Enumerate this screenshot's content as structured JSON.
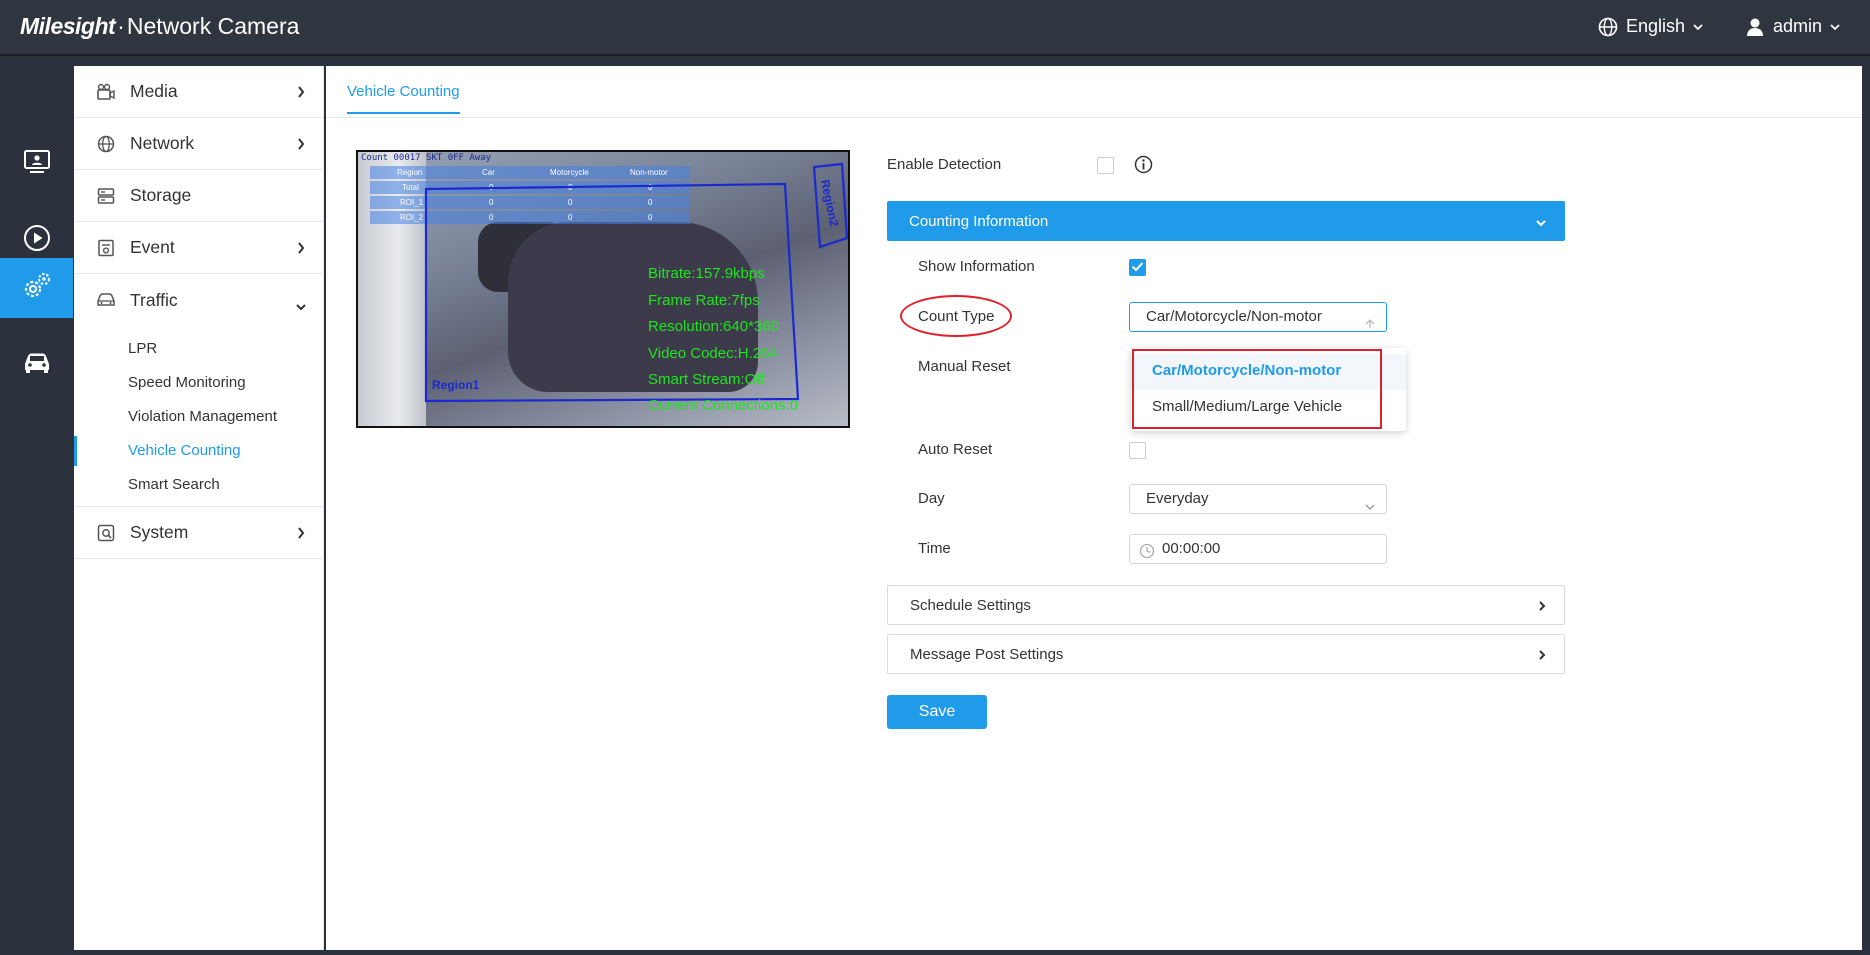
{
  "header": {
    "brand": "Milesight",
    "product": "Network Camera",
    "language": "English",
    "user": "admin"
  },
  "sidebar": {
    "items": [
      {
        "label": "Media",
        "icon": "media-icon"
      },
      {
        "label": "Network",
        "icon": "globe-icon"
      },
      {
        "label": "Storage",
        "icon": "storage-icon"
      },
      {
        "label": "Event",
        "icon": "event-icon"
      },
      {
        "label": "Traffic",
        "icon": "car-icon"
      }
    ],
    "traffic_sub": [
      "LPR",
      "Speed Monitoring",
      "Violation Management",
      "Vehicle Counting",
      "Smart Search"
    ],
    "system": {
      "label": "System",
      "icon": "system-icon"
    }
  },
  "main": {
    "tab": "Vehicle Counting"
  },
  "video": {
    "osd_title": "Count 00017 SKT 0FF Away",
    "table_headers": [
      "Region",
      "Car",
      "Motorcycle",
      "Non-motor"
    ],
    "table_rows": [
      [
        "Total",
        "0",
        "0",
        "0"
      ],
      [
        "ROI_1",
        "0",
        "0",
        "0"
      ],
      [
        "ROI_2",
        "0",
        "0",
        "0"
      ]
    ],
    "osd_lines": [
      "Bitrate:157.9kbps",
      "Frame Rate:7fps",
      "Resolution:640*360",
      "Video Codec:H.264",
      "Smart Stream:Off",
      "Current Connections:0"
    ],
    "region1": "Region1",
    "region2": "Region2"
  },
  "form": {
    "enable_detection": "Enable Detection",
    "counting_information": "Counting Information",
    "show_information": "Show Information",
    "count_type": "Count Type",
    "count_type_value": "Car/Motorcycle/Non-motor",
    "count_type_options": [
      "Car/Motorcycle/Non-motor",
      "Small/Medium/Large Vehicle"
    ],
    "manual_reset": "Manual Reset",
    "auto_reset": "Auto Reset",
    "day": "Day",
    "day_value": "Everyday",
    "time": "Time",
    "time_value": "00:00:00",
    "schedule_settings": "Schedule Settings",
    "message_post_settings": "Message Post Settings",
    "save": "Save"
  },
  "colors": {
    "accent": "#1f9bea",
    "header_bg": "#2f3640",
    "highlight_red": "#e0202a",
    "osd_green": "#1fe51f"
  }
}
